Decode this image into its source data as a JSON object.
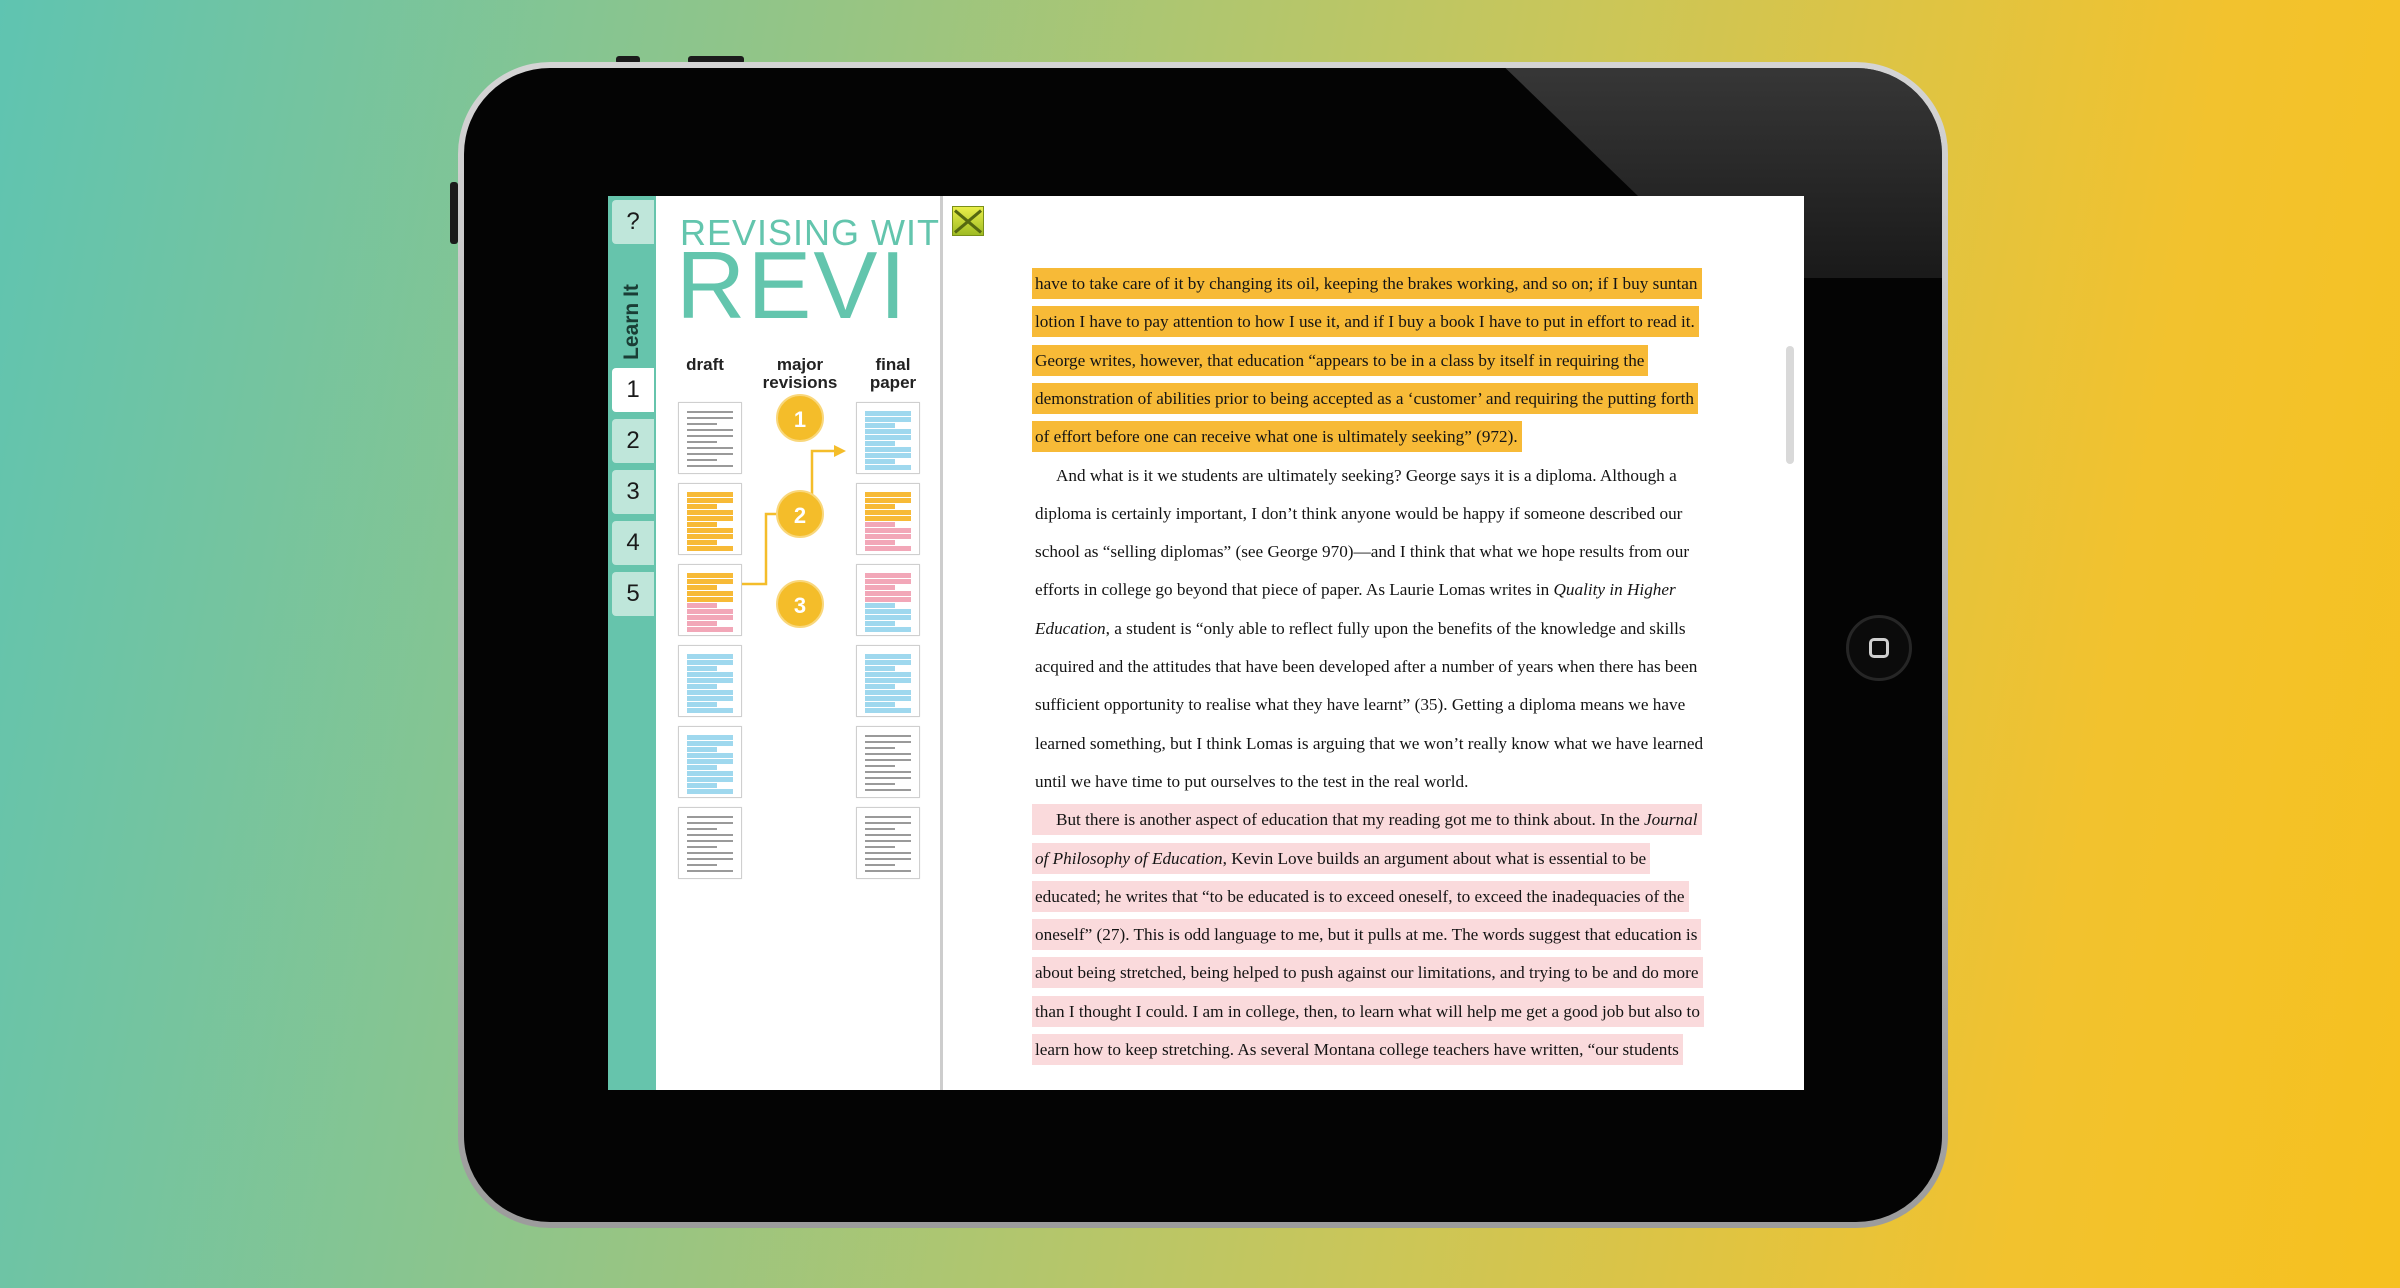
{
  "sidebar": {
    "help_label": "?",
    "section_label": "Learn It",
    "tabs": [
      "1",
      "2",
      "3",
      "4",
      "5"
    ],
    "active_tab": "1"
  },
  "app": {
    "title_small": "REVISING WIT",
    "title_big": "REVI"
  },
  "columns": {
    "draft": "draft",
    "major_revisions_line1": "major",
    "major_revisions_line2": "revisions",
    "final_line1": "final",
    "final_line2": "paper"
  },
  "steps": [
    "1",
    "2",
    "3"
  ],
  "colors": {
    "teal": "#66c4ac",
    "highlight_orange": "#f7ba37",
    "highlight_pink": "#fadadc",
    "step_badge": "#f4bd2a"
  },
  "document": {
    "close_icon": "close-icon",
    "lines": [
      {
        "hl": "orange",
        "text": "have to take care of it by changing its oil, keeping the brakes working, and so on; if I buy suntan"
      },
      {
        "hl": "orange",
        "text": "lotion I have to pay attention to how I use it, and if I buy a book I have to put in effort to read it."
      },
      {
        "hl": "orange",
        "text": "George writes, however, that education “appears to be in a class by itself in requiring the"
      },
      {
        "hl": "orange",
        "text": "demonstration of abilities prior to being accepted as a ‘customer’ and requiring the putting forth"
      },
      {
        "hl": "orange",
        "text": "of effort before one can receive what one is ultimately seeking” (972)."
      },
      {
        "hl": "",
        "text": "And what is it we students are ultimately seeking? George says it is a diploma. Although a",
        "indent": true
      },
      {
        "hl": "",
        "text": "diploma is certainly important, I don’t think anyone would be happy if someone described our"
      },
      {
        "hl": "",
        "text": "school as “selling diplomas” (see George 970)—and I think that what we hope results from our"
      },
      {
        "hl": "",
        "text": "efforts in college go beyond that piece of paper. As Laurie Lomas writes in ",
        "italic": "Quality in Higher"
      },
      {
        "hl": "",
        "italic_lead": "Education",
        "text": ", a student is “only able to reflect fully upon the benefits of the knowledge and skills"
      },
      {
        "hl": "",
        "text": "acquired and the attitudes that have been developed after a number of years when there has been"
      },
      {
        "hl": "",
        "text": "sufficient opportunity to realise what they have learnt” (35). Getting a diploma means we have"
      },
      {
        "hl": "",
        "text": "learned something, but I think Lomas is arguing that we won’t really know what we have learned"
      },
      {
        "hl": "",
        "text": "until we have time to put ourselves to the test in the real world."
      },
      {
        "hl": "pink",
        "text": "But there is another aspect of education that my reading got me to think about. In the ",
        "italic": "Journal",
        "indent": true
      },
      {
        "hl": "pink",
        "italic_lead": "of Philosophy of Education",
        "text": ", Kevin Love builds an argument about what is essential to be"
      },
      {
        "hl": "pink",
        "text": "educated; he writes that “to be educated is to exceed oneself, to exceed the inadequacies of the"
      },
      {
        "hl": "pink",
        "text": "oneself” (27). This is odd language to me, but it pulls at me. The words suggest that education is"
      },
      {
        "hl": "pink",
        "text": "about being stretched, being helped to push against our limitations, and trying to be and do more"
      },
      {
        "hl": "pink",
        "text": "than I thought I could. I am in college, then, to learn what will help me get a good job but also to"
      },
      {
        "hl": "pink",
        "text": "learn how to keep stretching. As several Montana college teachers have written, “our students"
      }
    ]
  }
}
